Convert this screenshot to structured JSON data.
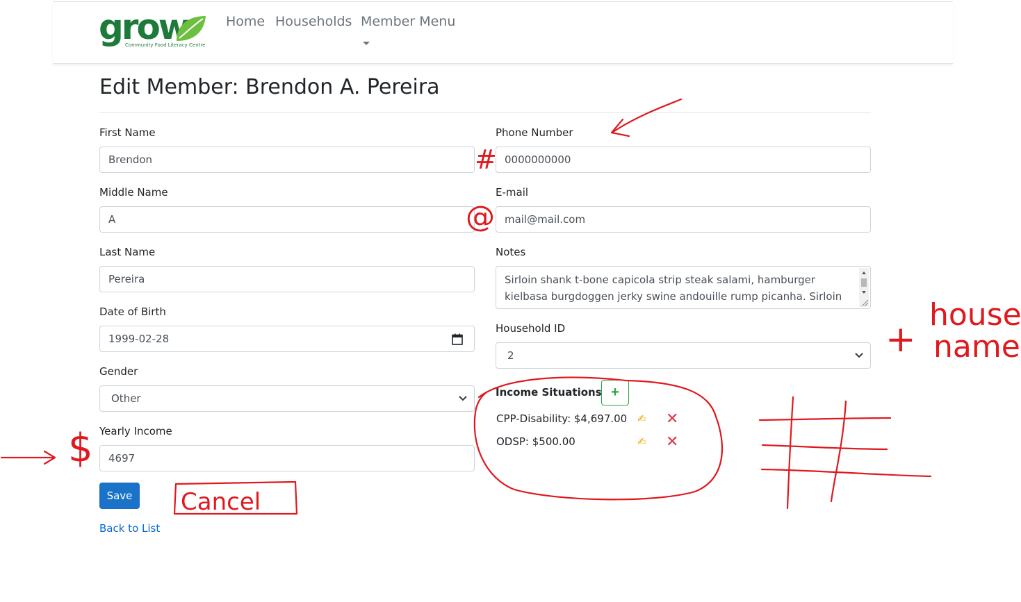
{
  "brand": {
    "name": "grow",
    "tagline": "Community Food Literacy Centre"
  },
  "nav": {
    "home": "Home",
    "households": "Households",
    "member_menu": "Member Menu"
  },
  "page": {
    "title": "Edit Member: Brendon A. Pereira"
  },
  "form": {
    "first_name": {
      "label": "First Name",
      "value": "Brendon"
    },
    "middle_name": {
      "label": "Middle Name",
      "value": "A"
    },
    "last_name": {
      "label": "Last Name",
      "value": "Pereira"
    },
    "dob": {
      "label": "Date of Birth",
      "value": "1999-02-28"
    },
    "gender": {
      "label": "Gender",
      "value": "Other"
    },
    "yearly_income": {
      "label": "Yearly Income",
      "value": "4697"
    },
    "phone": {
      "label": "Phone Number",
      "value": "0000000000"
    },
    "email": {
      "label": "E-mail",
      "value": "mail@mail.com"
    },
    "notes": {
      "label": "Notes",
      "value": "Sirloin shank t-bone capicola strip steak salami, hamburger kielbasa burgdoggen jerky swine andouille rump picanha. Sirloin porchetta"
    },
    "household_id": {
      "label": "Household ID",
      "value": "2"
    }
  },
  "income": {
    "title": "Income Situations",
    "add_label": "+",
    "items": [
      {
        "text": "CPP-Disability: $4,697.00"
      },
      {
        "text": "ODSP: $500.00"
      }
    ]
  },
  "actions": {
    "save": "Save",
    "back": "Back to List"
  },
  "annotations": {
    "hash": "#",
    "at": "@",
    "dollar": "$",
    "cancel": "Cancel",
    "plus": "+",
    "house": "house",
    "name": "name",
    "ink_color": "#e0191e"
  }
}
